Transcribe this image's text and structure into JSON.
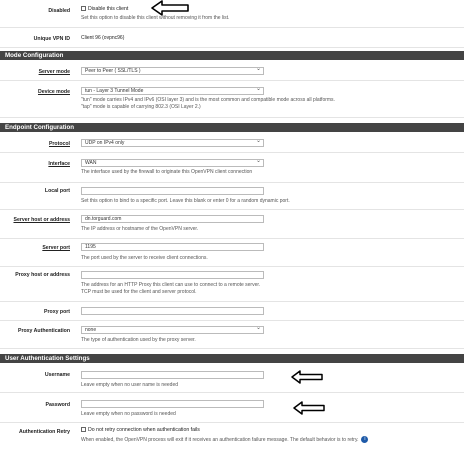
{
  "disabled": {
    "label": "Disabled",
    "checkbox_label": "Disable this client",
    "help": "Set this option to disable this client without removing it from the list."
  },
  "unique_vpn_id": {
    "label": "Unique VPN ID",
    "value": "Client 96 (ovpnc96)"
  },
  "mode_config": {
    "title": "Mode Configuration",
    "server_mode": {
      "label": "Server mode",
      "value": "Peer to Peer ( SSL/TLS )"
    },
    "device_mode": {
      "label": "Device mode",
      "value": "tun - Layer 3 Tunnel Mode",
      "help1": "\"tun\" mode carries IPv4 and IPv6 (OSI layer 3) and is the most common and compatible mode across all platforms.",
      "help2": "\"tap\" mode is capable of carrying 802.3 (OSI Layer 2.)"
    }
  },
  "endpoint_config": {
    "title": "Endpoint Configuration",
    "protocol": {
      "label": "Protocol",
      "value": "UDP on IPv4 only"
    },
    "interface": {
      "label": "Interface",
      "value": "WAN",
      "help": "The interface used by the firewall to originate this OpenVPN client connection"
    },
    "local_port": {
      "label": "Local port",
      "value": "",
      "help": "Set this option to bind to a specific port. Leave this blank or enter 0 for a random dynamic port."
    },
    "server_host": {
      "label": "Server host or address",
      "value": "dn.torguard.com",
      "help": "The IP address or hostname of the OpenVPN server."
    },
    "server_port": {
      "label": "Server port",
      "value": "1195",
      "help": "The port used by the server to receive client connections."
    },
    "proxy_host": {
      "label": "Proxy host or address",
      "value": "",
      "help1": "The address for an HTTP Proxy this client can use to connect to a remote server.",
      "help2": "TCP must be used for the client and server protocol."
    },
    "proxy_port": {
      "label": "Proxy port",
      "value": ""
    },
    "proxy_auth": {
      "label": "Proxy Authentication",
      "value": "none",
      "help": "The type of authentication used by the proxy server."
    }
  },
  "user_auth": {
    "title": "User Authentication Settings",
    "username": {
      "label": "Username",
      "value": "",
      "help": "Leave empty when no user name is needed"
    },
    "password": {
      "label": "Password",
      "value": "",
      "help": "Leave empty when no password is needed"
    },
    "auth_retry": {
      "label": "Authentication Retry",
      "checkbox_label": "Do not retry connection when authentication fails",
      "help": "When enabled, the OpenVPN process will exit if it receives an authentication failure message. The default behavior is to retry."
    }
  },
  "annotations": {
    "arrow_icon": "left-arrow-outline",
    "accent": "#000000"
  },
  "colors": {
    "section_bg": "#444444",
    "info_icon": "#1e5aa8"
  }
}
